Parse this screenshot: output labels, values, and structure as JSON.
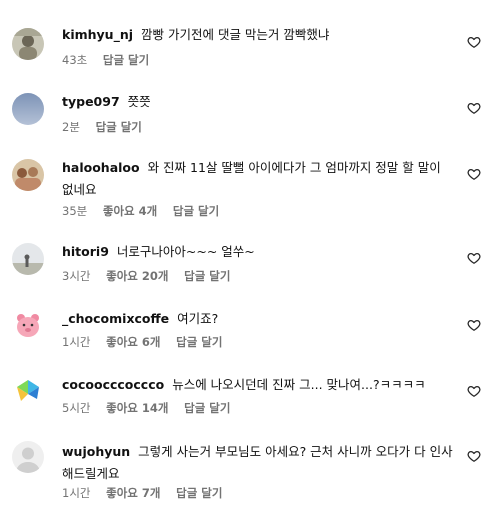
{
  "comments": [
    {
      "username": "kimhyu_nj",
      "text": "깜빵 가기전에 댓글 막는거 깜빡했냐",
      "time": "43초",
      "likes": "",
      "reply": "답글 달기",
      "avatar_color": "#9a9a86"
    },
    {
      "username": "type097",
      "text": "쯧쯧",
      "time": "2분",
      "likes": "",
      "reply": "답글 달기",
      "avatar_color": "#8aa0bd"
    },
    {
      "username": "haloohaloo",
      "text": "와 진짜 11살 딸뻘 아이에다가 그 엄마까지 정말 할 말이 없네요",
      "time": "35분",
      "likes": "좋아요 4개",
      "reply": "답글 달기",
      "avatar_color": "#b89a7a"
    },
    {
      "username": "hitori9",
      "text": "너로구나아아~~~ 얼쑤~",
      "time": "3시간",
      "likes": "좋아요 20개",
      "reply": "답글 달기",
      "avatar_color": "#c9ced2"
    },
    {
      "username": "_chocomixcoffe",
      "text": "여기죠?",
      "time": "1시간",
      "likes": "좋아요 6개",
      "reply": "답글 달기",
      "avatar_color": "#f6b7c4"
    },
    {
      "username": "cocoocccoccco",
      "text": "뉴스에 나오시던데 진짜 그... 맞나여...?ㅋㅋㅋㅋ",
      "time": "5시간",
      "likes": "좋아요 14개",
      "reply": "답글 달기",
      "avatar_color": "#ffffff"
    },
    {
      "username": "wujohyun",
      "text": "그렇게 사는거 부모님도 아세요? 근처 사니까 오다가 다 인사해드릴게요",
      "time": "1시간",
      "likes": "좋아요 7개",
      "reply": "답글 달기",
      "avatar_color": "#dcdcdc"
    }
  ],
  "colors": {
    "meta": "#737373",
    "text": "#111111",
    "heart": "#262626"
  }
}
